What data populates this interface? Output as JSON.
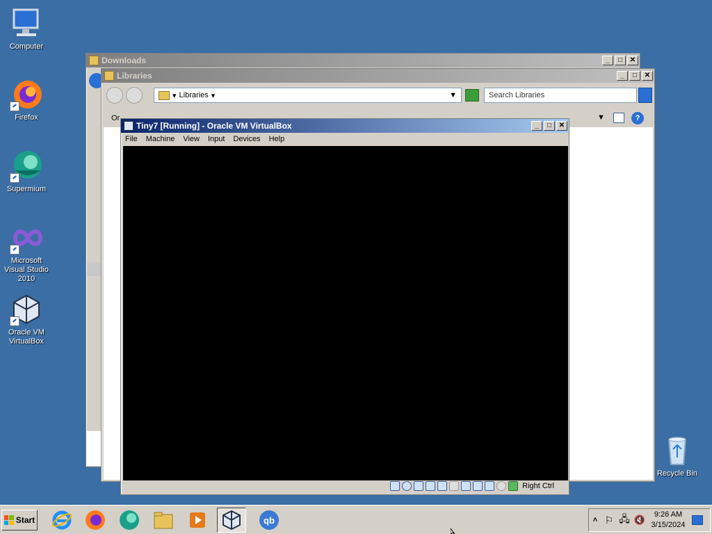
{
  "desktop": {
    "icons": [
      {
        "label": "Computer"
      },
      {
        "label": "Firefox"
      },
      {
        "label": "Supermium"
      },
      {
        "label": "Microsoft Visual Studio 2010"
      },
      {
        "label": "Oracle VM VirtualBox"
      },
      {
        "label": "Recycle Bin"
      }
    ]
  },
  "downloads_window": {
    "title": "Downloads"
  },
  "libraries_window": {
    "title": "Libraries",
    "address": "Libraries",
    "search_placeholder": "Search Libraries",
    "organize_label": "Or"
  },
  "virtualbox_window": {
    "title": "Tiny7 [Running] - Oracle VM VirtualBox",
    "menu": [
      "File",
      "Machine",
      "View",
      "Input",
      "Devices",
      "Help"
    ],
    "host_key": "Right Ctrl"
  },
  "taskbar": {
    "start_label": "Start",
    "clock_time": "9:26 AM",
    "clock_date": "3/15/2024"
  },
  "colors": {
    "desktop": "#3a6ea5",
    "title_active": "#0a246a",
    "title_inactive": "#808080"
  }
}
